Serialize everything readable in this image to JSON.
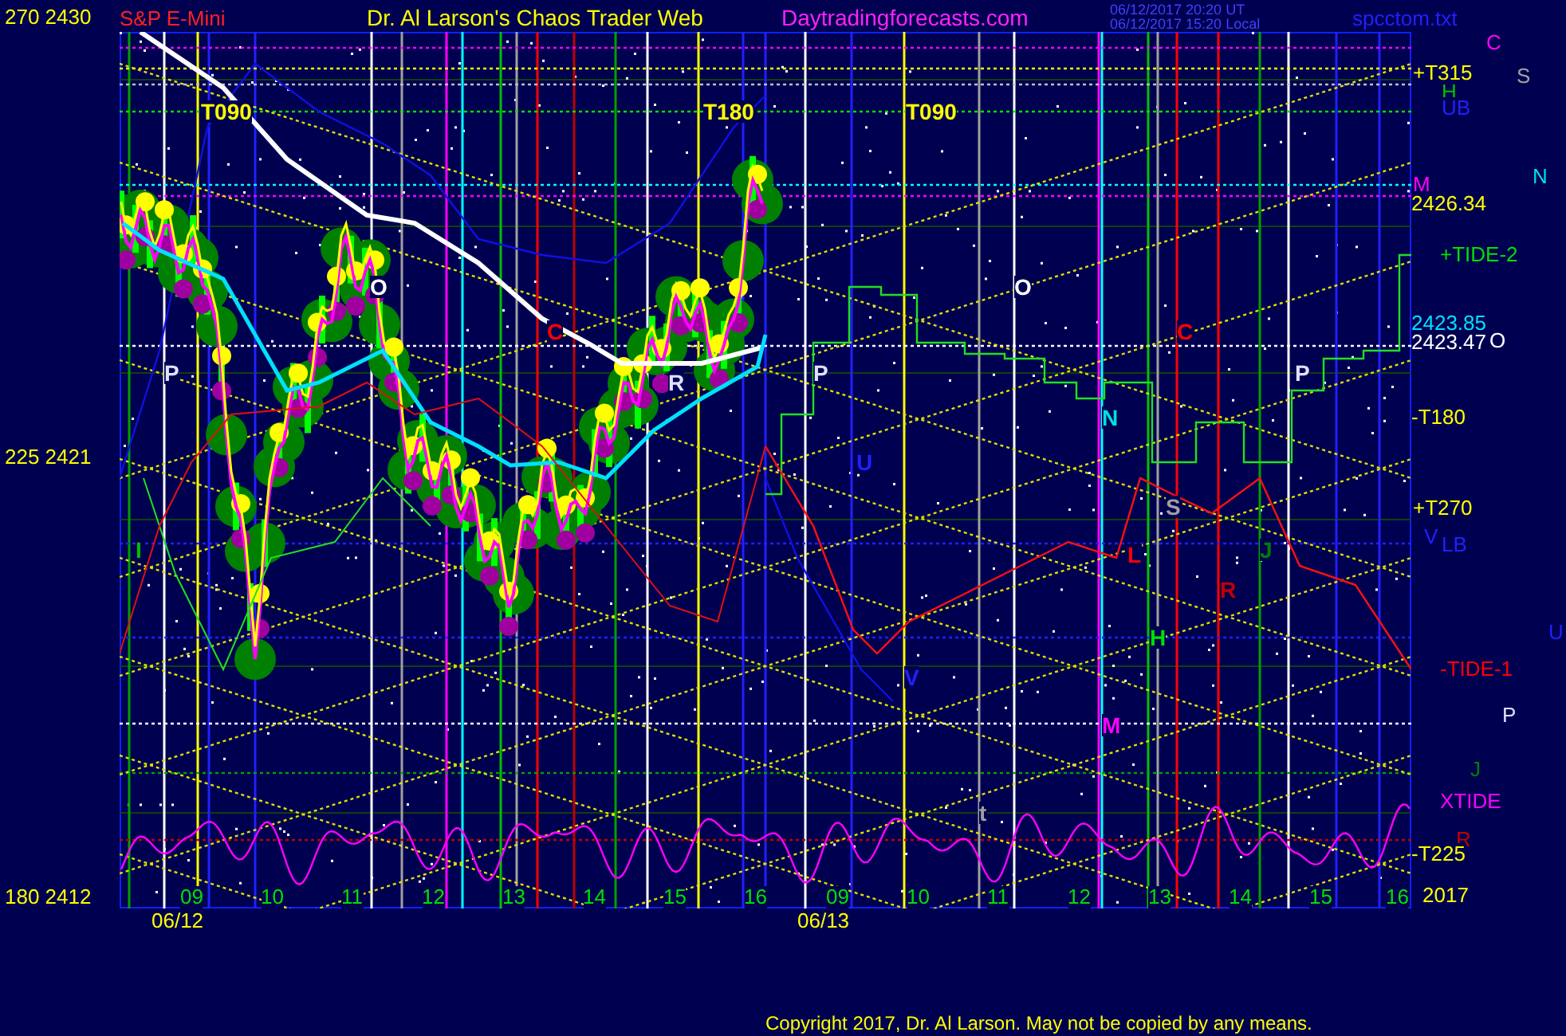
{
  "header": {
    "symbol": "S&P E-Mini",
    "title": "Dr. Al Larson's Chaos Trader Web",
    "site": "Daytradingforecasts.com",
    "timestamps": [
      "06/12/2017 20:20 UT",
      "06/12/2017 15:20 Local"
    ],
    "file": "spcctom.txt"
  },
  "left_axis": [
    {
      "angle": "270",
      "price": "2430"
    },
    {
      "angle": "225",
      "price": "2421"
    },
    {
      "angle": "180",
      "price": "2412"
    }
  ],
  "right_labels": [
    {
      "text": "C",
      "color": "#ff00ff"
    },
    {
      "text": "+T315",
      "color": "#ffff00"
    },
    {
      "text": "S",
      "color": "#a0a0a0"
    },
    {
      "text": "H",
      "color": "#00c000"
    },
    {
      "text": "UB",
      "color": "#2020ff"
    },
    {
      "text": "M",
      "color": "#ff00ff"
    },
    {
      "text": "N",
      "color": "#00e0e0"
    },
    {
      "text": "2426.34",
      "color": "#ffff00"
    },
    {
      "text": "+TIDE-2",
      "color": "#00e000"
    },
    {
      "text": "2423.85",
      "color": "#00e0ff"
    },
    {
      "text": "2423.47",
      "color": "#ffffff"
    },
    {
      "text": "O",
      "color": "#ffffff"
    },
    {
      "text": "-T180",
      "color": "#ffff00"
    },
    {
      "text": "+T270",
      "color": "#ffff00"
    },
    {
      "text": "V",
      "color": "#2020ff"
    },
    {
      "text": "LB",
      "color": "#2020ff"
    },
    {
      "text": "U",
      "color": "#2020ff"
    },
    {
      "text": "-TIDE-1",
      "color": "#ff0000"
    },
    {
      "text": "P",
      "color": "#e0e0ff"
    },
    {
      "text": "J",
      "color": "#008000"
    },
    {
      "text": "XTIDE",
      "color": "#ff00ff"
    },
    {
      "text": "R",
      "color": "#c00000"
    },
    {
      "text": "-T225",
      "color": "#ffff00"
    },
    {
      "text": "2017",
      "color": "#ffff00"
    }
  ],
  "chart_labels": [
    {
      "text": "T090",
      "color": "#ffff00"
    },
    {
      "text": "T180",
      "color": "#ffff00"
    },
    {
      "text": "T090",
      "color": "#ffff00"
    },
    {
      "text": "O",
      "color": "#ffffff"
    },
    {
      "text": "P",
      "color": "#e0e0ff"
    },
    {
      "text": "C",
      "color": "#ff0000"
    },
    {
      "text": "R",
      "color": "#e0e0ff"
    },
    {
      "text": "O",
      "color": "#ffffff"
    },
    {
      "text": "P",
      "color": "#e0e0ff"
    },
    {
      "text": "C",
      "color": "#ff0000"
    },
    {
      "text": "N",
      "color": "#00e0e0"
    },
    {
      "text": "P",
      "color": "#e0e0ff"
    },
    {
      "text": "U",
      "color": "#2020ff"
    },
    {
      "text": "S",
      "color": "#a0a0a0"
    },
    {
      "text": "L",
      "color": "#ff0000"
    },
    {
      "text": "J",
      "color": "#008000"
    },
    {
      "text": "R",
      "color": "#c00000"
    },
    {
      "text": "H",
      "color": "#00e000"
    },
    {
      "text": "V",
      "color": "#2020ff"
    },
    {
      "text": "M",
      "color": "#ff00ff"
    },
    {
      "text": "t",
      "color": "#a0a0a0"
    },
    {
      "text": "I",
      "color": "#00c000"
    }
  ],
  "hours": [
    "09",
    "10",
    "11",
    "12",
    "13",
    "14",
    "15",
    "16",
    "09",
    "10",
    "11",
    "12",
    "13",
    "14",
    "15",
    "16"
  ],
  "dates": [
    "06/12",
    "06/13"
  ],
  "copyright": "Copyright 2017, Dr. Al Larson. May not be copied by any means."
}
